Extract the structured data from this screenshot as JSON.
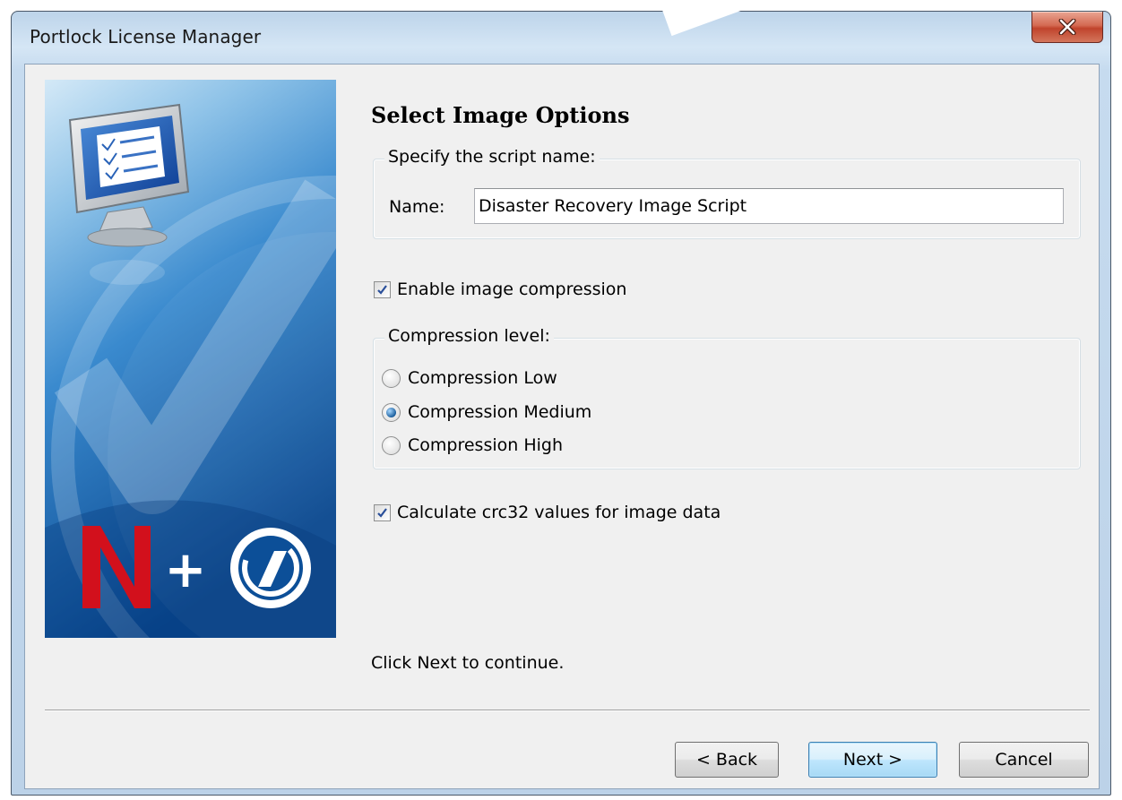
{
  "window": {
    "title": "Portlock License Manager",
    "close_icon": "close-x-icon"
  },
  "banner": {
    "icons": [
      "monitor-checklist-icon",
      "novell-n-logo",
      "plus-sign",
      "portlock-logo"
    ],
    "plus_text": "+",
    "colors": {
      "top": "#c9e2f4",
      "mid": "#3e8fcf",
      "bottom": "#0b4f97",
      "novell_red": "#d2101c"
    }
  },
  "page": {
    "heading": "Select Image Options",
    "script_group": {
      "legend": "Specify the script name:",
      "name_label": "Name:",
      "name_value": "Disaster Recovery Image Script"
    },
    "enable_compression": {
      "label": "Enable image compression",
      "checked": true
    },
    "compression_group": {
      "legend": "Compression level:",
      "options": [
        {
          "label": "Compression Low",
          "selected": false
        },
        {
          "label": "Compression Medium",
          "selected": true
        },
        {
          "label": "Compression High",
          "selected": false
        }
      ]
    },
    "crc32": {
      "label": "Calculate crc32 values for image data",
      "checked": true
    },
    "status_text": "Click Next to continue."
  },
  "buttons": {
    "back": "< Back",
    "next": "Next >",
    "cancel": "Cancel"
  }
}
